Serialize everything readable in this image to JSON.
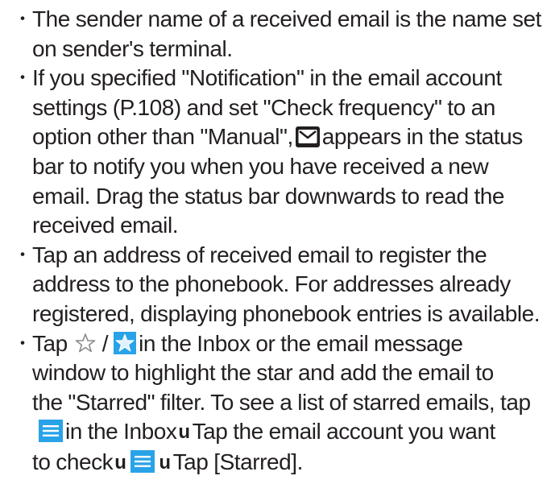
{
  "bullet_symbol": "・",
  "arrow_symbol": "u",
  "colors": {
    "text": "#231f20",
    "icon_blue": "#29a3e8",
    "star_fill": "#3a9ee8",
    "star_outline": "#8a8a8a"
  },
  "icons": {
    "envelope": "envelope-icon",
    "star_outline": "star-outline-icon",
    "star_filled": "star-filled-icon",
    "menu": "menu-icon"
  },
  "notes": {
    "n1": {
      "l1": "The sender name of a received email is the name set",
      "l2": "on sender's terminal."
    },
    "n2": {
      "l1": "If you specified \"Notification\" in the email account",
      "l2": "settings (P.108) and set \"Check frequency\" to an",
      "l3a": "option other than \"Manual\",",
      "l3b": "appears in the status",
      "l4": "bar to notify you when you have received a new",
      "l5": "email. Drag the status bar downwards to read the",
      "l6": "received email."
    },
    "n3": {
      "l1": "Tap an address of received email to register the",
      "l2": "address to the phonebook. For addresses already",
      "l3": "registered, displaying phonebook entries is available."
    },
    "n4": {
      "l1a": "Tap",
      "l1sep": "/",
      "l1b": "in the Inbox or the email message",
      "l2": "window to highlight the star and add the email to",
      "l3": "the \"Starred\" filter. To see a list of starred emails, tap",
      "l4a": "in the Inbox",
      "l4b": "Tap the email account you want",
      "l5a": "to check",
      "l5b": "Tap [Starred]."
    }
  }
}
